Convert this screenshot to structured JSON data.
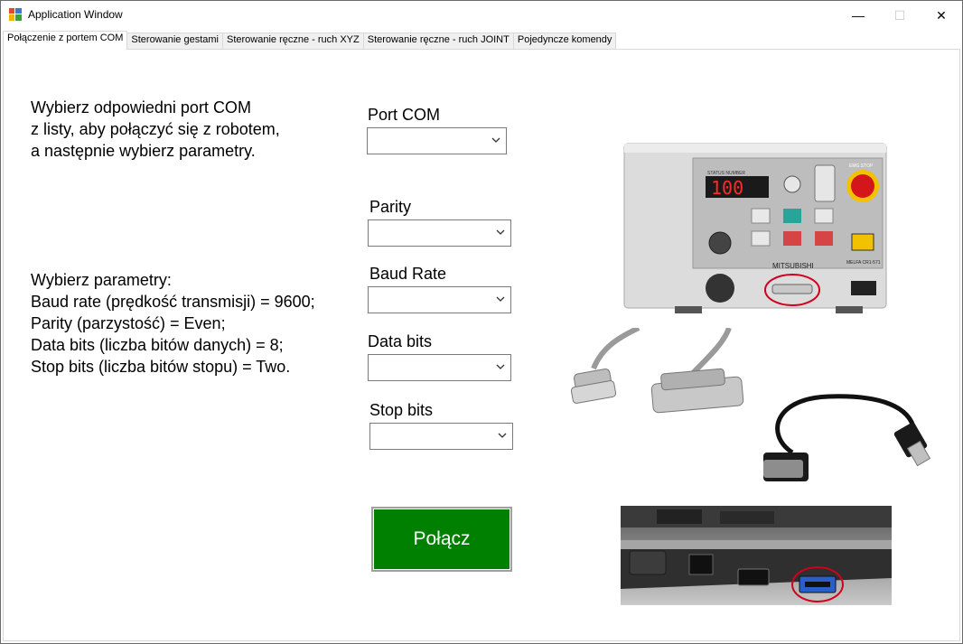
{
  "window": {
    "title": "Application Window",
    "minimize_glyph": "—",
    "maximize_glyph": "☐",
    "close_glyph": "✕"
  },
  "tabs": [
    {
      "label": "Połączenie z portem COM",
      "active": true
    },
    {
      "label": "Sterowanie gestami",
      "active": false
    },
    {
      "label": "Sterowanie ręczne - ruch XYZ",
      "active": false
    },
    {
      "label": "Sterowanie ręczne - ruch JOINT",
      "active": false
    },
    {
      "label": "Pojedyncze komendy",
      "active": false
    }
  ],
  "intro": {
    "line1": "Wybierz odpowiedni port COM",
    "line2": "z listy, aby połączyć się z robotem,",
    "line3": "a następnie  wybierz parametry."
  },
  "params": {
    "heading": "Wybierz parametry:",
    "baud": "Baud rate (prędkość transmisji) = 9600;",
    "parity": "Parity (parzystość) = Even;",
    "databits": "Data bits (liczba bitów danych) = 8;",
    "stopbits": "Stop bits (liczba bitów stopu) = Two."
  },
  "fields": {
    "port": {
      "label": "Port COM",
      "value": ""
    },
    "parity": {
      "label": "Parity",
      "value": ""
    },
    "baud": {
      "label": "Baud Rate",
      "value": ""
    },
    "databits": {
      "label": "Data bits",
      "value": ""
    },
    "stopbits": {
      "label": "Stop bits",
      "value": ""
    }
  },
  "connect_label": "Połącz",
  "controller_image": {
    "display": "100",
    "brand": "MITSUBISHI",
    "model": "MELFA CR1-571",
    "status_label": "STATUS NUMBER",
    "emg_label": "EMG.STOP"
  },
  "colors": {
    "connect_bg": "#008000",
    "emg_red": "#d4161c",
    "annotation_red": "#d0001c"
  }
}
